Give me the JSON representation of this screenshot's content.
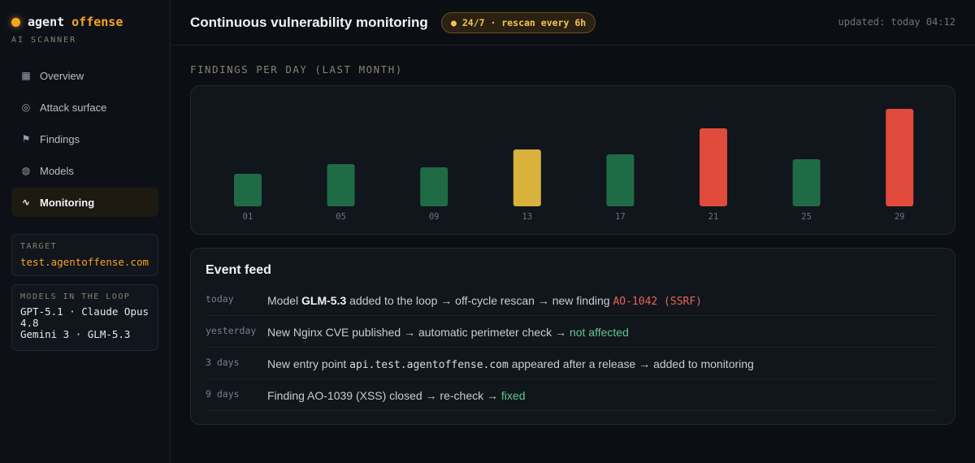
{
  "brand": {
    "name_a": "agent",
    "name_b": "offense",
    "subtitle": "AI SCANNER"
  },
  "sidebar": {
    "items": [
      {
        "label": "Overview",
        "icon": "grid-icon",
        "glyph": "▦",
        "active": false
      },
      {
        "label": "Attack surface",
        "icon": "target-icon",
        "glyph": "◎",
        "active": false
      },
      {
        "label": "Findings",
        "icon": "flag-icon",
        "glyph": "⚑",
        "active": false
      },
      {
        "label": "Models",
        "icon": "model-icon",
        "glyph": "◍",
        "active": false
      },
      {
        "label": "Monitoring",
        "icon": "pulse-icon",
        "glyph": "∿",
        "active": true
      }
    ],
    "target": {
      "label": "TARGET",
      "value": "test.agentoffense.com"
    },
    "models": {
      "label": "MODELS IN THE LOOP",
      "line1": "GPT-5.1 · Claude Opus 4.8",
      "line2": "Gemini 3 · GLM-5.3"
    }
  },
  "header": {
    "title": "Continuous vulnerability monitoring",
    "badge": "● 24/7 · rescan every 6h",
    "updated": "updated: today 04:12"
  },
  "chart_section_title": "FINDINGS PER DAY (LAST MONTH)",
  "chart_data": {
    "type": "bar",
    "categories": [
      "01",
      "05",
      "09",
      "13",
      "17",
      "21",
      "25",
      "29"
    ],
    "values": [
      4,
      5.2,
      4.8,
      7,
      6.4,
      9.6,
      5.8,
      12
    ],
    "ylim": [
      0,
      12
    ],
    "bar_colors": [
      "#1f6b45",
      "#1f6b45",
      "#1f6b45",
      "#d8b23a",
      "#1f6b45",
      "#e04b3c",
      "#1f6b45",
      "#e04b3c"
    ],
    "grid": false
  },
  "feed": {
    "title": "Event feed",
    "rows": [
      {
        "when": "today",
        "p1": "Model ",
        "p2": "GLM-5.3",
        "p3": " added to the loop ",
        "p4": "→",
        "p5": " off-cycle rescan ",
        "p6": "→",
        "p7": " new finding ",
        "p8": "AO-1042 (SSRF)"
      },
      {
        "when": "yesterday",
        "p1": "New Nginx CVE published ",
        "p2": "→",
        "p3": " automatic perimeter check ",
        "p4": "→",
        "p5": " ",
        "p6": "not affected"
      },
      {
        "when": "3 days",
        "p1": "New entry point ",
        "p2": "api.test.agentoffense.com",
        "p3": " appeared after a release ",
        "p4": "→",
        "p5": " added to monitoring"
      },
      {
        "when": "9 days",
        "p1": "Finding AO-1039 (XSS) closed ",
        "p2": "→",
        "p3": " re-check ",
        "p4": "→",
        "p5": " ",
        "p6": "fixed"
      }
    ]
  },
  "colors": {
    "accent": "#f5a524",
    "danger": "#e04b3c",
    "ok": "#1f6b45",
    "warn": "#d8b23a"
  }
}
